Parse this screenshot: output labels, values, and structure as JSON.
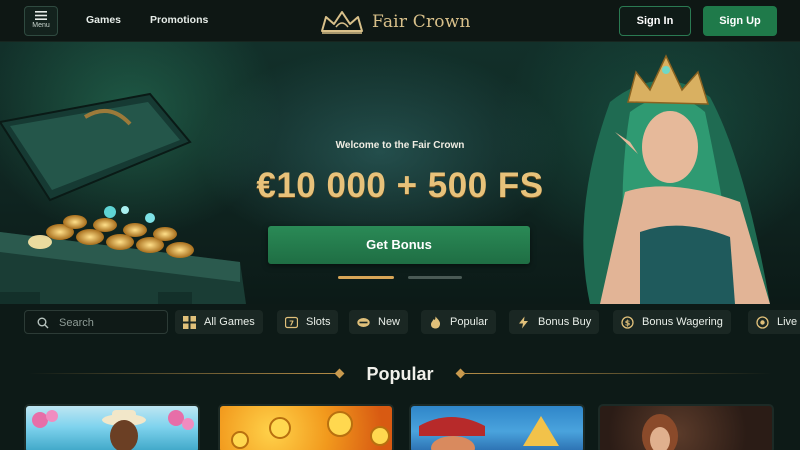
{
  "header": {
    "menu_label": "Menu",
    "nav": [
      "Games",
      "Promotions"
    ],
    "brand": "Fair Crown",
    "sign_in": "Sign In",
    "sign_up": "Sign Up"
  },
  "hero": {
    "welcome": "Welcome to the Fair Crown",
    "offer": "€10 000 + 500 FS",
    "cta": "Get Bonus",
    "slides": {
      "count": 2,
      "active": 1
    }
  },
  "search": {
    "placeholder": "Search"
  },
  "categories": [
    {
      "label": "All Games",
      "icon": "grid-icon"
    },
    {
      "label": "Slots",
      "icon": "slot-machine-icon"
    },
    {
      "label": "New",
      "icon": "new-badge-icon"
    },
    {
      "label": "Popular",
      "icon": "flame-icon"
    },
    {
      "label": "Bonus Buy",
      "icon": "lightning-icon"
    },
    {
      "label": "Bonus Wagering",
      "icon": "coin-exchange-icon"
    },
    {
      "label": "Live",
      "icon": "live-dealer-icon"
    }
  ],
  "section": {
    "title": "Popular"
  },
  "games": [
    {
      "icon": "beach-dealer-thumbnail"
    },
    {
      "icon": "gold-coins-thumbnail"
    },
    {
      "icon": "pirate-thumbnail"
    },
    {
      "icon": "lady-portrait-thumbnail"
    }
  ],
  "colors": {
    "background": "#0d1a17",
    "accent_green": "#1f7a4a",
    "gold": "#e8c27a",
    "chip_bg": "#1a2723"
  }
}
